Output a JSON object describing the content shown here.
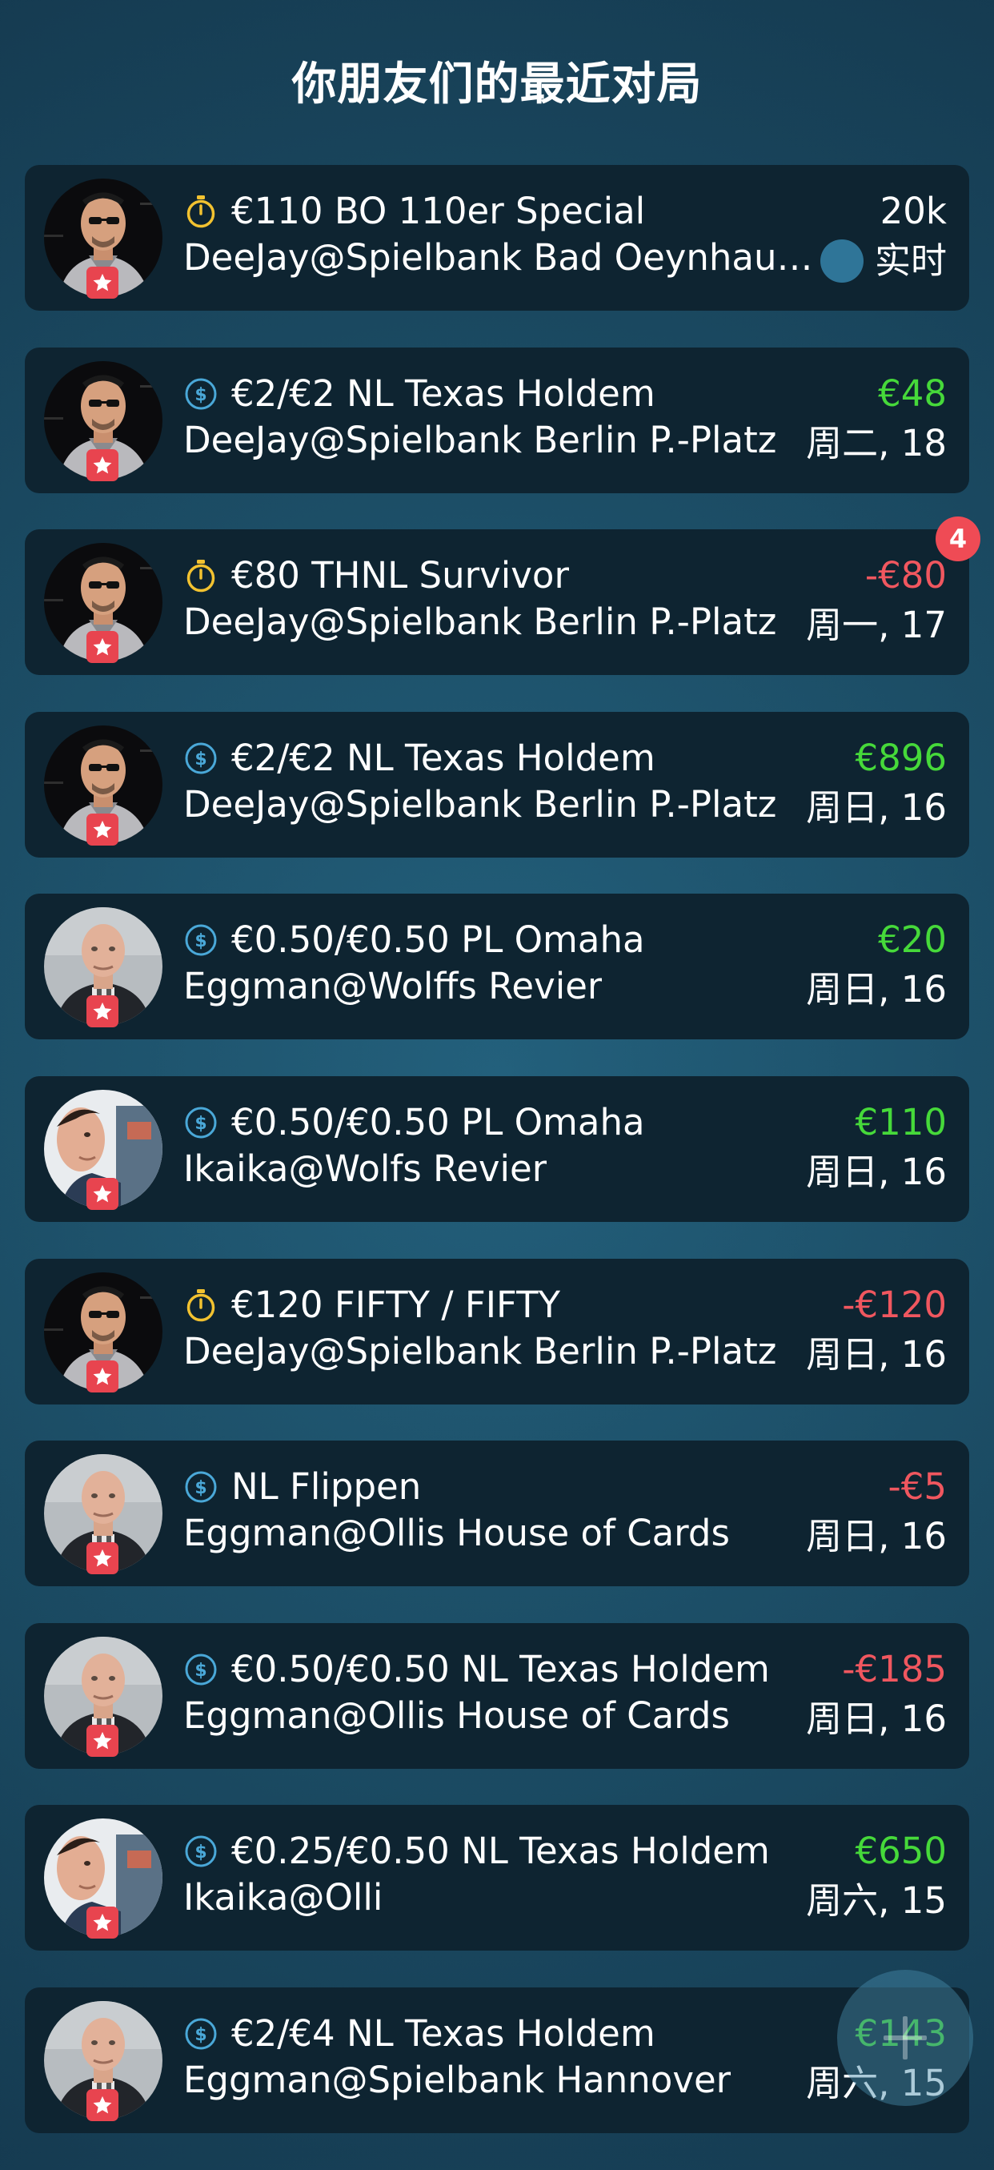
{
  "page_title": "你朋友们的最近对局",
  "colors": {
    "positive": "#46d93a",
    "negative": "#f0575f",
    "neutral": "#ffffff",
    "tournament_icon": "#f2c230",
    "cash_icon": "#4aa8d8"
  },
  "games": [
    {
      "type": "tournament",
      "icon": "stopwatch-icon",
      "title": "€110 BO 110er Special",
      "venue": "DeeJay@Spielbank Bad Oeynhausen",
      "amount": "20k",
      "amount_style": "neutral",
      "date": "实时",
      "live": true,
      "avatar": "deejay"
    },
    {
      "type": "cash",
      "icon": "dollar-coin-icon",
      "title": "€2/€2 NL Texas Holdem",
      "venue": "DeeJay@Spielbank Berlin P.-Platz",
      "amount": "€48",
      "amount_style": "positive",
      "date": "周二, 18",
      "avatar": "deejay"
    },
    {
      "type": "tournament",
      "icon": "stopwatch-icon",
      "title": "€80 THNL Survivor",
      "venue": "DeeJay@Spielbank Berlin P.-Platz",
      "amount": "-€80",
      "amount_style": "negative",
      "date": "周一, 17",
      "badge": "4",
      "avatar": "deejay"
    },
    {
      "type": "cash",
      "icon": "dollar-coin-icon",
      "title": "€2/€2 NL Texas Holdem",
      "venue": "DeeJay@Spielbank Berlin P.-Platz",
      "amount": "€896",
      "amount_style": "positive",
      "date": "周日, 16",
      "avatar": "deejay"
    },
    {
      "type": "cash",
      "icon": "dollar-coin-icon",
      "title": "€0.50/€0.50 PL Omaha",
      "venue": "Eggman@Wolffs Revier",
      "amount": "€20",
      "amount_style": "positive",
      "date": "周日, 16",
      "avatar": "eggman"
    },
    {
      "type": "cash",
      "icon": "dollar-coin-icon",
      "title": "€0.50/€0.50 PL Omaha",
      "venue": "Ikaika@Wolfs Revier",
      "amount": "€110",
      "amount_style": "positive",
      "date": "周日, 16",
      "avatar": "ikaika"
    },
    {
      "type": "tournament",
      "icon": "stopwatch-icon",
      "title": "€120 FIFTY / FIFTY",
      "venue": "DeeJay@Spielbank Berlin P.-Platz",
      "amount": "-€120",
      "amount_style": "negative",
      "date": "周日, 16",
      "avatar": "deejay"
    },
    {
      "type": "cash",
      "icon": "dollar-coin-icon",
      "title": "NL Flippen",
      "venue": "Eggman@Ollis House of Cards",
      "amount": "-€5",
      "amount_style": "negative",
      "date": "周日, 16",
      "avatar": "eggman"
    },
    {
      "type": "cash",
      "icon": "dollar-coin-icon",
      "title": "€0.50/€0.50 NL Texas Holdem",
      "venue": "Eggman@Ollis House of Cards",
      "amount": "-€185",
      "amount_style": "negative",
      "date": "周日, 16",
      "avatar": "eggman"
    },
    {
      "type": "cash",
      "icon": "dollar-coin-icon",
      "title": "€0.25/€0.50 NL Texas Holdem",
      "venue": "Ikaika@Olli",
      "amount": "€650",
      "amount_style": "positive",
      "date": "周六, 15",
      "avatar": "ikaika"
    },
    {
      "type": "cash",
      "icon": "dollar-coin-icon",
      "title": "€2/€4 NL Texas Holdem",
      "venue": "Eggman@Spielbank Hannover",
      "amount": "€143",
      "amount_style": "positive",
      "date": "周六, 15",
      "avatar": "eggman"
    }
  ],
  "fab": {
    "icon": "add-icon"
  }
}
